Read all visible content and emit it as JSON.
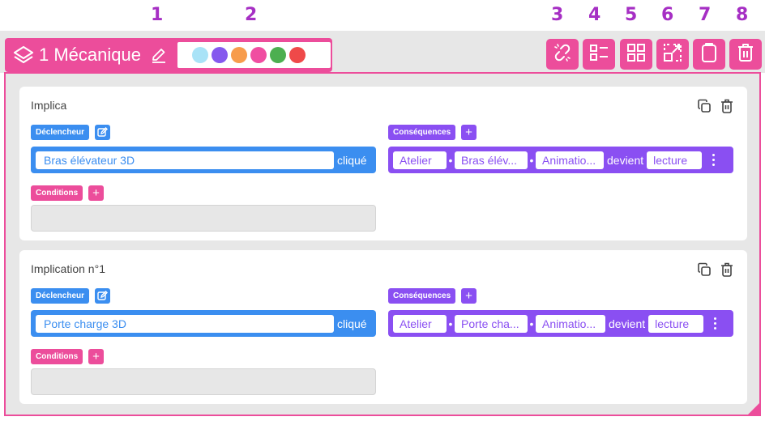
{
  "callouts": [
    "1",
    "2",
    "3",
    "4",
    "5",
    "6",
    "7",
    "8"
  ],
  "layer": {
    "title": "1 Mécanique",
    "icon": "layers-icon"
  },
  "palette": [
    "#a9e3f7",
    "#8559ee",
    "#f79c4c",
    "#f04da1",
    "#4caf50",
    "#ef4949"
  ],
  "colors": {
    "accent": "#ec4d9b",
    "trigger": "#3b8ef0",
    "consequence": "#8a4ff2",
    "background": "#e7e7e7"
  },
  "toolbar_icons": [
    "unlink-icon",
    "list-view-icon",
    "grid-view-icon",
    "resize-icon",
    "clipboard-icon",
    "trash-icon"
  ],
  "labels": {
    "trigger": "Déclencheur",
    "consequences": "Conséquences",
    "conditions": "Conditions",
    "clicked": "cliqué",
    "becomes": "devient"
  },
  "implications": [
    {
      "title": "Implica",
      "trigger_object": "Bras élévateur 3D",
      "consequence": {
        "scene": "Atelier",
        "object": "Bras élév...",
        "property": "Animatio...",
        "value": "lecture"
      }
    },
    {
      "title": "Implication n°1",
      "trigger_object": "Porte charge 3D",
      "consequence": {
        "scene": "Atelier",
        "object": "Porte cha...",
        "property": "Animatio...",
        "value": "lecture"
      }
    }
  ]
}
